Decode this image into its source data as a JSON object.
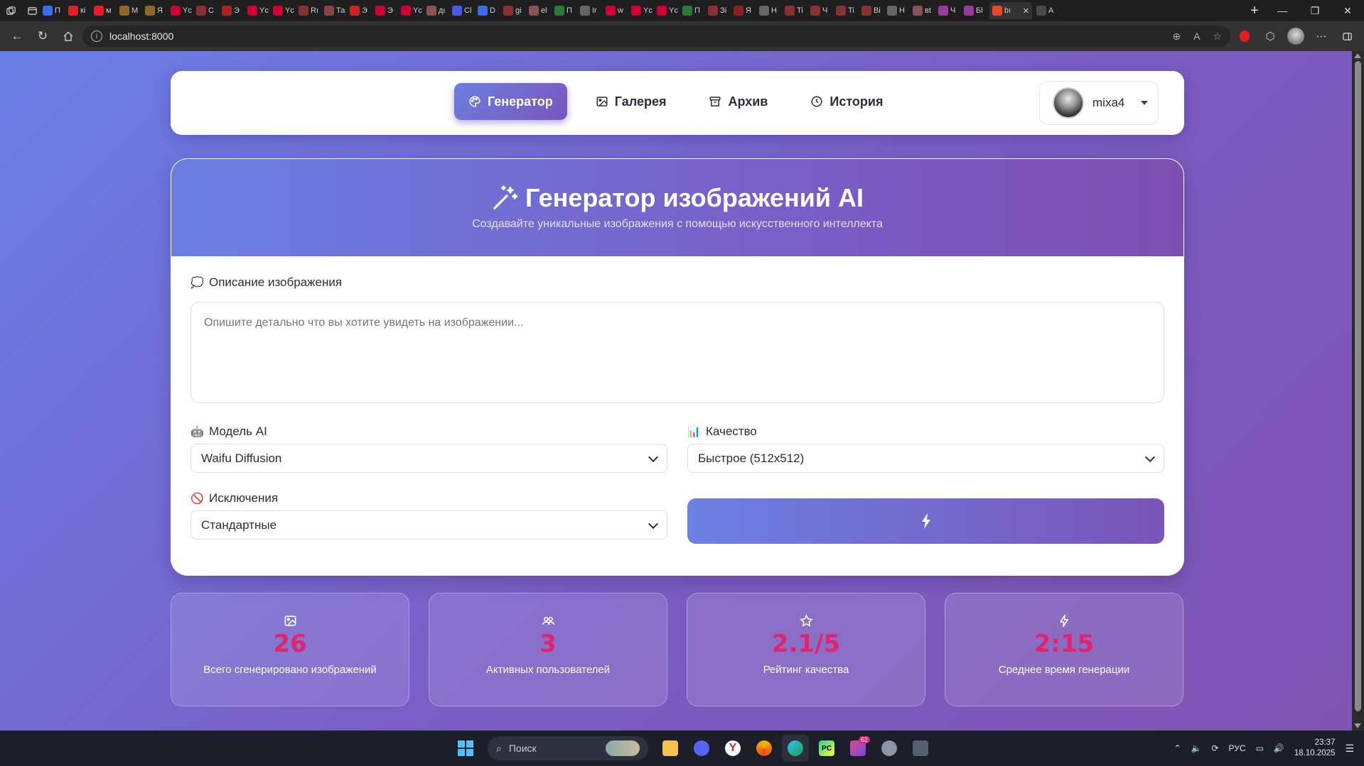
{
  "browser": {
    "url": "localhost:8000",
    "tabs": [
      {
        "label": "П",
        "color": "#3a6ee8"
      },
      {
        "label": "кі",
        "color": "#e61e26"
      },
      {
        "label": "м",
        "color": "#e61e26"
      },
      {
        "label": "М",
        "color": "#8a6a2a"
      },
      {
        "label": "Я",
        "color": "#8a6a2a"
      },
      {
        "label": "Yc",
        "color": "#cc0033"
      },
      {
        "label": "С",
        "color": "#883333"
      },
      {
        "label": "Э",
        "color": "#aa2222"
      },
      {
        "label": "Yc",
        "color": "#cc0033"
      },
      {
        "label": "Yc",
        "color": "#cc0033"
      },
      {
        "label": "Rı",
        "color": "#883333"
      },
      {
        "label": "Та",
        "color": "#884444"
      },
      {
        "label": "Э",
        "color": "#cc2222"
      },
      {
        "label": "Э",
        "color": "#cc0033"
      },
      {
        "label": "Yc",
        "color": "#cc0033"
      },
      {
        "label": "дı",
        "color": "#885555"
      },
      {
        "label": "Cl",
        "color": "#4a5ae0"
      },
      {
        "label": "D",
        "color": "#3a6ee8"
      },
      {
        "label": "gi",
        "color": "#883333"
      },
      {
        "label": "el",
        "color": "#885555"
      },
      {
        "label": "П",
        "color": "#2a7a3a"
      },
      {
        "label": "Ir",
        "color": "#666666"
      },
      {
        "label": "w",
        "color": "#cc0033"
      },
      {
        "label": "Yc",
        "color": "#cc0033"
      },
      {
        "label": "Yc",
        "color": "#cc0033"
      },
      {
        "label": "П",
        "color": "#2a7a3a"
      },
      {
        "label": "Зі",
        "color": "#883333"
      },
      {
        "label": "Я",
        "color": "#882222"
      },
      {
        "label": "Н",
        "color": "#666666"
      },
      {
        "label": "Ti",
        "color": "#883333"
      },
      {
        "label": "Ч",
        "color": "#883333"
      },
      {
        "label": "Ti",
        "color": "#883333"
      },
      {
        "label": "Ві",
        "color": "#883333"
      },
      {
        "label": "Н",
        "color": "#666666"
      },
      {
        "label": "вt",
        "color": "#885555"
      },
      {
        "label": "Ч",
        "color": "#9a3a9a"
      },
      {
        "label": "Бl",
        "color": "#9a3a9a"
      },
      {
        "label": "bı",
        "color": "#e64a2a"
      },
      {
        "label": "A",
        "color": "#4a4a4a"
      }
    ]
  },
  "nav": {
    "items": [
      {
        "label": "Генератор",
        "icon": "palette-icon",
        "active": true
      },
      {
        "label": "Галерея",
        "icon": "image-icon",
        "active": false
      },
      {
        "label": "Архив",
        "icon": "archive-icon",
        "active": false
      },
      {
        "label": "История",
        "icon": "clock-icon",
        "active": false
      }
    ],
    "user": {
      "name": "mixa4"
    }
  },
  "generator": {
    "title": "Генератор изображений AI",
    "subtitle": "Создавайте уникальные изображения с помощью искусственного интеллекта",
    "prompt": {
      "label": "Описание изображения",
      "emoji": "💭",
      "placeholder": "Опишите детально что вы хотите увидеть на изображении...",
      "value": ""
    },
    "model": {
      "label": "Модель AI",
      "emoji": "🤖",
      "value": "Waifu Diffusion"
    },
    "quality": {
      "label": "Качество",
      "emoji": "📊",
      "value": "Быстрое (512x512)"
    },
    "exclusions": {
      "label": "Исключения",
      "emoji": "🚫",
      "value": "Стандартные"
    },
    "generate_button": {
      "icon": "bolt-icon"
    }
  },
  "stats": [
    {
      "icon": "image-icon",
      "value": "26",
      "label": "Всего сгенерировано изображений"
    },
    {
      "icon": "users-icon",
      "value": "3",
      "label": "Активных пользователей"
    },
    {
      "icon": "star-icon",
      "value": "2.1/5",
      "label": "Рейтинг качества"
    },
    {
      "icon": "bolt-icon",
      "value": "2:15",
      "label": "Среднее время генерации"
    }
  ],
  "taskbar": {
    "search_placeholder": "Поиск",
    "language": "РУС",
    "time": "23:37",
    "date": "18.10.2025",
    "badge": "62"
  },
  "colors": {
    "accent_start": "#6b7fe0",
    "accent_end": "#7a55bd",
    "stat_value": "#e0246e"
  }
}
